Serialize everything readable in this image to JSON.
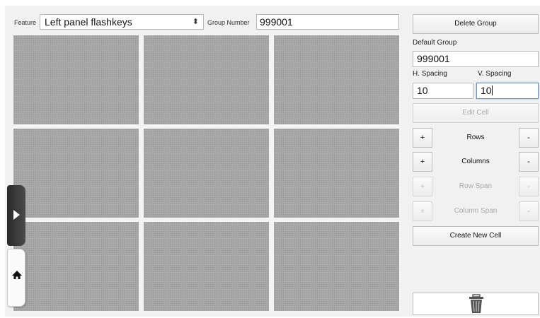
{
  "toolbar": {
    "feature_label": "Feature",
    "feature_value": "Left panel flashkeys",
    "group_number_label": "Group Number",
    "group_number_value": "999001"
  },
  "side_tabs": {
    "play_icon": "play-icon",
    "home_icon": "home-icon"
  },
  "panel": {
    "delete_group": "Delete Group",
    "default_group_label": "Default Group",
    "default_group_value": "999001",
    "h_spacing_label": "H. Spacing",
    "h_spacing_value": "10",
    "v_spacing_label": "V. Spacing",
    "v_spacing_value": "10",
    "edit_cell": "Edit Cell",
    "rows_label": "Rows",
    "columns_label": "Columns",
    "row_span_label": "Row Span",
    "column_span_label": "Column Span",
    "plus": "+",
    "minus": "-",
    "create_new_cell": "Create New Cell",
    "trash_icon": "trash-icon"
  },
  "grid": {
    "rows": 3,
    "columns": 3
  },
  "colors": {
    "cell_fill": "#a9a9a9",
    "panel_background": "#f1f1f1",
    "focus_border": "#6d8fb4"
  }
}
